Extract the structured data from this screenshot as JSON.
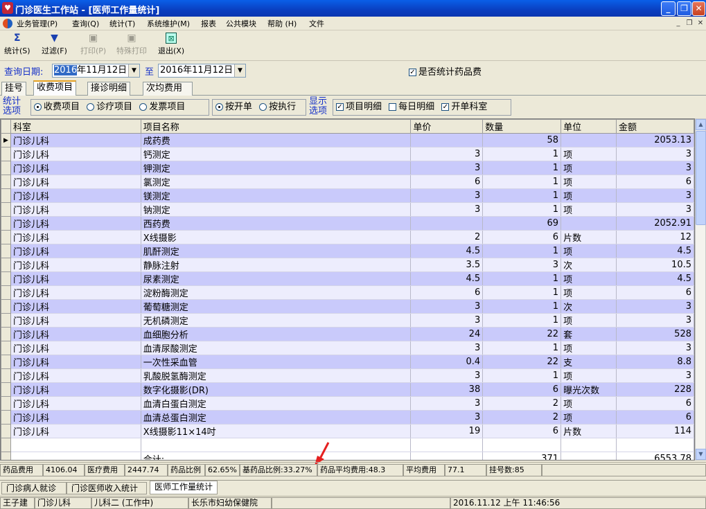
{
  "window": {
    "title": "门诊医生工作站 - [医师工作量统计]",
    "app_icon": "app-shield-icon"
  },
  "menubar": [
    "业务管理(P)",
    "查询(Q)",
    "统计(T)",
    "系统维护(M)",
    "报表",
    "公共模块",
    "帮助 (H)",
    "文件"
  ],
  "toolbar": [
    {
      "label": "统计(S)",
      "icon": "sigma-icon",
      "enabled": true
    },
    {
      "label": "过滤(F)",
      "icon": "filter-icon",
      "enabled": true
    },
    {
      "label": "打印(P)",
      "icon": "printer-icon",
      "enabled": false
    },
    {
      "label": "特殊打印",
      "icon": "printer-icon",
      "enabled": false
    },
    {
      "label": "退出(X)",
      "icon": "exit-icon",
      "enabled": true
    }
  ],
  "query": {
    "date_label": "查询日期:",
    "start_year_selected": "2016",
    "start_rest": "年11月12日",
    "to_label": "至",
    "end_date": "2016年11月12日",
    "drug_fee_label": "是否统计药品费",
    "drug_fee_checked": true
  },
  "tabs": [
    "挂号",
    "收费项目",
    "接诊明细",
    "次均费用"
  ],
  "active_tab": 1,
  "options": {
    "stat_label": "统计\n选项",
    "stat_options": [
      {
        "label": "收费项目",
        "on": true
      },
      {
        "label": "诊疗项目",
        "on": false
      },
      {
        "label": "发票项目",
        "on": false
      }
    ],
    "by_options": [
      {
        "label": "按开单",
        "on": true
      },
      {
        "label": "按执行",
        "on": false
      }
    ],
    "display_label": "显示\n选项",
    "display_options": [
      {
        "label": "项目明细",
        "on": true
      },
      {
        "label": "每日明细",
        "on": false
      },
      {
        "label": "开单科室",
        "on": true
      }
    ]
  },
  "grid": {
    "columns": [
      "科室",
      "项目名称",
      "单价",
      "数量",
      "单位",
      "金额"
    ],
    "rows": [
      [
        "门诊儿科",
        "成药费",
        "",
        "58",
        "",
        "2053.13"
      ],
      [
        "门诊儿科",
        "钙测定",
        "3",
        "1",
        "项",
        "3"
      ],
      [
        "门诊儿科",
        "钾测定",
        "3",
        "1",
        "项",
        "3"
      ],
      [
        "门诊儿科",
        "氯测定",
        "6",
        "1",
        "项",
        "6"
      ],
      [
        "门诊儿科",
        "镁测定",
        "3",
        "1",
        "项",
        "3"
      ],
      [
        "门诊儿科",
        "钠测定",
        "3",
        "1",
        "项",
        "3"
      ],
      [
        "门诊儿科",
        "西药费",
        "",
        "69",
        "",
        "2052.91"
      ],
      [
        "门诊儿科",
        "X线摄影",
        "2",
        "6",
        "片数",
        "12"
      ],
      [
        "门诊儿科",
        "肌酐测定",
        "4.5",
        "1",
        "项",
        "4.5"
      ],
      [
        "门诊儿科",
        "静脉注射",
        "3.5",
        "3",
        "次",
        "10.5"
      ],
      [
        "门诊儿科",
        "尿素测定",
        "4.5",
        "1",
        "项",
        "4.5"
      ],
      [
        "门诊儿科",
        "淀粉酶测定",
        "6",
        "1",
        "项",
        "6"
      ],
      [
        "门诊儿科",
        "葡萄糖测定",
        "3",
        "1",
        "次",
        "3"
      ],
      [
        "门诊儿科",
        "无机磷测定",
        "3",
        "1",
        "项",
        "3"
      ],
      [
        "门诊儿科",
        "血细胞分析",
        "24",
        "22",
        "套",
        "528"
      ],
      [
        "门诊儿科",
        "血清尿酸测定",
        "3",
        "1",
        "项",
        "3"
      ],
      [
        "门诊儿科",
        "一次性采血管",
        "0.4",
        "22",
        "支",
        "8.8"
      ],
      [
        "门诊儿科",
        "乳酸脱氢酶测定",
        "3",
        "1",
        "项",
        "3"
      ],
      [
        "门诊儿科",
        "数字化摄影(DR)",
        "38",
        "6",
        "曝光次数",
        "228"
      ],
      [
        "门诊儿科",
        "血清白蛋白测定",
        "3",
        "2",
        "项",
        "6"
      ],
      [
        "门诊儿科",
        "血清总蛋白测定",
        "3",
        "2",
        "项",
        "6"
      ],
      [
        "门诊儿科",
        "X线摄影11×14吋",
        "19",
        "6",
        "片数",
        "114"
      ]
    ],
    "total": {
      "label": "合计:",
      "qty": "371",
      "amount": "6553.78"
    }
  },
  "stats": [
    {
      "text": "药品费用"
    },
    {
      "text": "4106.04"
    },
    {
      "text": "医疗费用"
    },
    {
      "text": "2447.74"
    },
    {
      "text": "药品比例"
    },
    {
      "text": "62.65%"
    },
    {
      "text": "基药品比例:33.27%"
    },
    {
      "text": "药品平均费用:48.3"
    },
    {
      "text": "平均费用"
    },
    {
      "text": "77.1"
    },
    {
      "text": "挂号数:85"
    }
  ],
  "accent_color": "#316ac5",
  "row_color_a": "#c9cafb",
  "row_color_b": "#ededfd",
  "bottom_tabs": [
    "门诊病人就诊",
    "门诊医师收入统计",
    "医师工作量统计"
  ],
  "active_bottom_tab": 2,
  "statusbar": [
    "王子建",
    "门诊儿科",
    "儿科二 (工作中)",
    "长乐市妇幼保健院",
    "",
    "2016.11.12 上午 11:46:56"
  ]
}
